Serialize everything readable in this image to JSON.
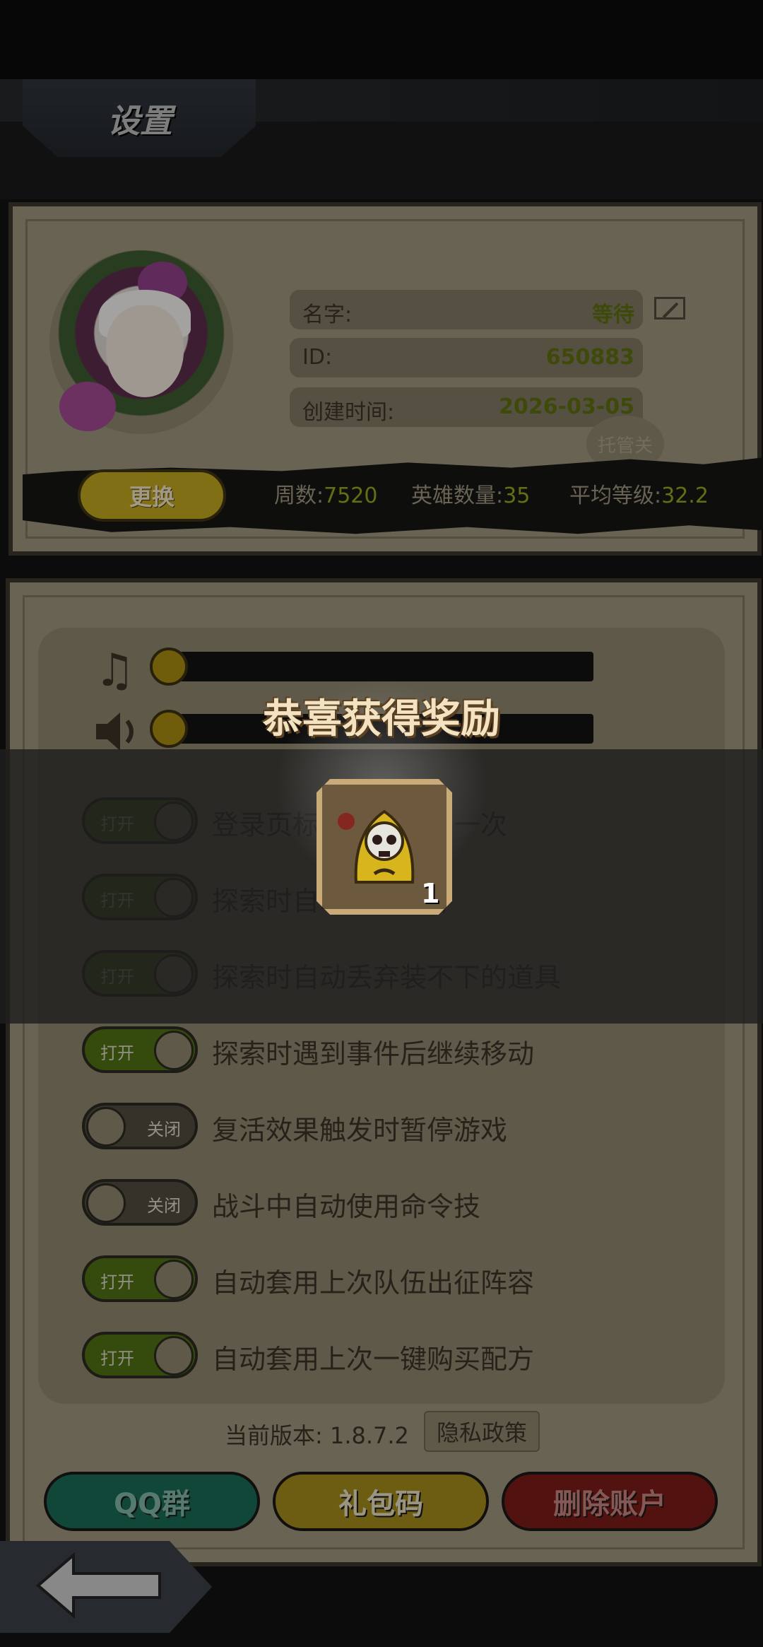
{
  "header": {
    "title": "设置"
  },
  "profile": {
    "name_label": "名字:",
    "name_value": "等待",
    "id_label": "ID:",
    "id_value": "650883",
    "created_label": "创建时间:",
    "created_value": "2026-03-05",
    "auto_label": "托管关",
    "change_label": "更换",
    "stats": {
      "weeks_label": "周数:",
      "weeks_value": "7520",
      "heroes_label": "英雄数量:",
      "heroes_value": "35",
      "avg_label": "平均等级:",
      "avg_value": "32.2"
    }
  },
  "audio": {
    "music_icon": "music-note-icon",
    "sound_icon": "speaker-icon",
    "music_level": 0,
    "sound_level": 0
  },
  "options": [
    {
      "text": "登录页标题一天显示一次",
      "state": "on",
      "state_label": "打开"
    },
    {
      "text": "探索时自动响应事件",
      "state": "on",
      "state_label": "打开"
    },
    {
      "text": "探索时自动丢弃装不下的道具",
      "state": "on",
      "state_label": "打开"
    },
    {
      "text": "探索时遇到事件后继续移动",
      "state": "on",
      "state_label": "打开"
    },
    {
      "text": "复活效果触发时暂停游戏",
      "state": "off",
      "state_label": "关闭"
    },
    {
      "text": "战斗中自动使用命令技",
      "state": "off",
      "state_label": "关闭"
    },
    {
      "text": "自动套用上次队伍出征阵容",
      "state": "on",
      "state_label": "打开"
    },
    {
      "text": "自动套用上次一键购买配方",
      "state": "on",
      "state_label": "打开"
    }
  ],
  "footer": {
    "version_text": "当前版本: 1.8.7.2",
    "privacy_label": "隐私政策",
    "qq_label": "QQ群",
    "gift_label": "礼包码",
    "delete_label": "删除账户",
    "back_icon": "back-arrow-icon"
  },
  "reward_popup": {
    "title": "恭喜获得奖励",
    "item_icon": "skull-bell-icon",
    "item_count": "1"
  },
  "colors": {
    "parchment": "#9b927c",
    "toggle_on": "#4d6f14",
    "toggle_off": "#4f4a3e",
    "gold_button": "#bfa420",
    "qq_button": "#186954",
    "delete_button": "#7a1d18"
  }
}
